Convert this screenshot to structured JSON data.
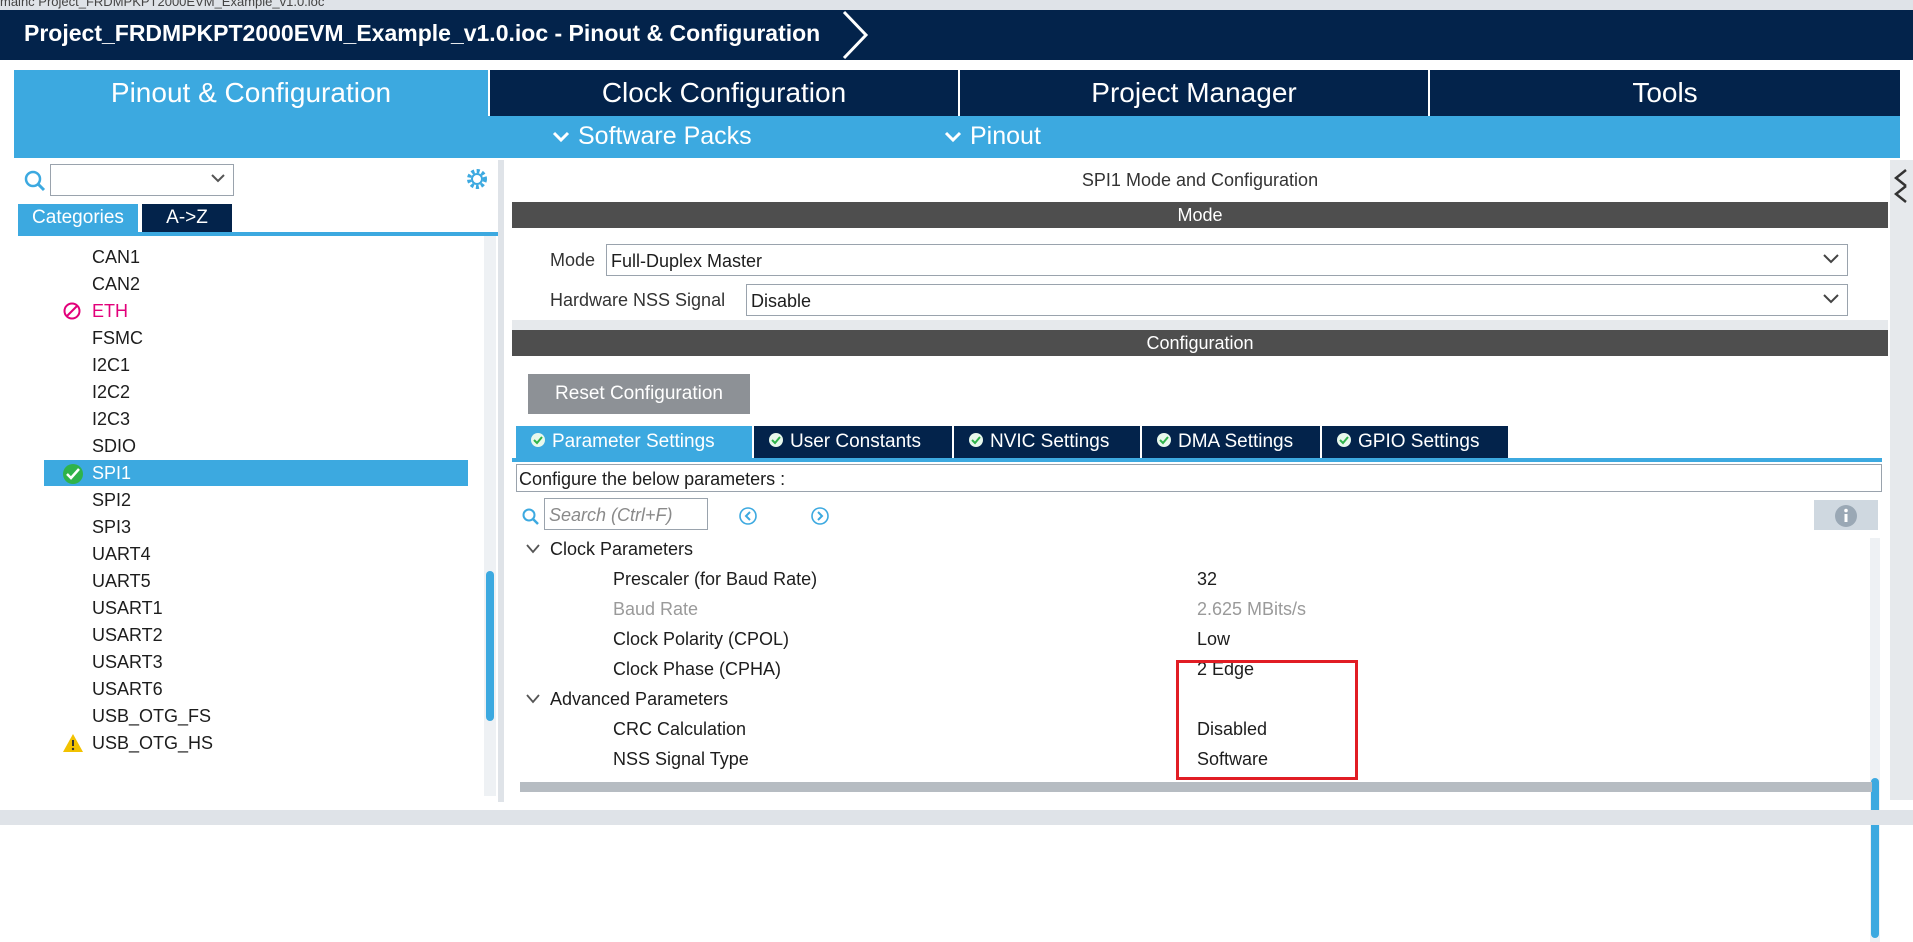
{
  "window": {
    "top_tabs_partial": "mainc    Project_FRDMPKPT2000EVM_Example_v1.0.ioc",
    "title": "Project_FRDMPKPT2000EVM_Example_v1.0.ioc - Pinout & Configuration"
  },
  "main_tabs": [
    {
      "label": "Pinout & Configuration",
      "active": true
    },
    {
      "label": "Clock Configuration",
      "active": false
    },
    {
      "label": "Project Manager",
      "active": false
    },
    {
      "label": "Tools",
      "active": false
    }
  ],
  "sub_menu": {
    "software_packs": "Software Packs",
    "pinout": "Pinout"
  },
  "left_panel": {
    "search_value": "",
    "tabs": {
      "categories": "Categories",
      "az": "A->Z"
    },
    "items": [
      {
        "label": "CAN1",
        "status": "none"
      },
      {
        "label": "CAN2",
        "status": "none"
      },
      {
        "label": "ETH",
        "status": "unavailable"
      },
      {
        "label": "FSMC",
        "status": "none"
      },
      {
        "label": "I2C1",
        "status": "none"
      },
      {
        "label": "I2C2",
        "status": "none"
      },
      {
        "label": "I2C3",
        "status": "none"
      },
      {
        "label": "SDIO",
        "status": "none"
      },
      {
        "label": "SPI1",
        "status": "configured"
      },
      {
        "label": "SPI2",
        "status": "none"
      },
      {
        "label": "SPI3",
        "status": "none"
      },
      {
        "label": "UART4",
        "status": "none"
      },
      {
        "label": "UART5",
        "status": "none"
      },
      {
        "label": "USART1",
        "status": "none"
      },
      {
        "label": "USART2",
        "status": "none"
      },
      {
        "label": "USART3",
        "status": "none"
      },
      {
        "label": "USART6",
        "status": "none"
      },
      {
        "label": "USB_OTG_FS",
        "status": "none"
      },
      {
        "label": "USB_OTG_HS",
        "status": "warning"
      }
    ]
  },
  "right_panel": {
    "title": "SPI1 Mode and Configuration",
    "mode_header": "Mode",
    "mode_label": "Mode",
    "mode_value": "Full-Duplex Master",
    "nss_label": "Hardware NSS Signal",
    "nss_value": "Disable",
    "config_header": "Configuration",
    "reset_button": "Reset Configuration",
    "tabs": [
      {
        "label": "Parameter Settings",
        "active": true
      },
      {
        "label": "User Constants",
        "active": false
      },
      {
        "label": "NVIC Settings",
        "active": false
      },
      {
        "label": "DMA Settings",
        "active": false
      },
      {
        "label": "GPIO Settings",
        "active": false
      }
    ],
    "configure_text": "Configure the below parameters :",
    "search_placeholder": "Search (Ctrl+F)",
    "groups": [
      {
        "name": "Clock Parameters",
        "params": [
          {
            "name": "Prescaler (for Baud Rate)",
            "value": "32",
            "disabled": false
          },
          {
            "name": "Baud Rate",
            "value": "2.625 MBits/s",
            "disabled": true
          },
          {
            "name": "Clock Polarity (CPOL)",
            "value": "Low",
            "disabled": false
          },
          {
            "name": "Clock Phase (CPHA)",
            "value": "2 Edge",
            "disabled": false
          }
        ]
      },
      {
        "name": "Advanced Parameters",
        "params": [
          {
            "name": "CRC Calculation",
            "value": "Disabled",
            "disabled": false
          },
          {
            "name": "NSS Signal Type",
            "value": "Software",
            "disabled": false
          }
        ]
      }
    ]
  },
  "colors": {
    "navy": "#03234b",
    "accent_blue": "#3ca9e0",
    "header_gray": "#4e4e4e",
    "highlight_red": "#e11d24",
    "error_pink": "#e2007a",
    "ok_green": "#2fb34a",
    "warn_yellow": "#f2c200"
  }
}
